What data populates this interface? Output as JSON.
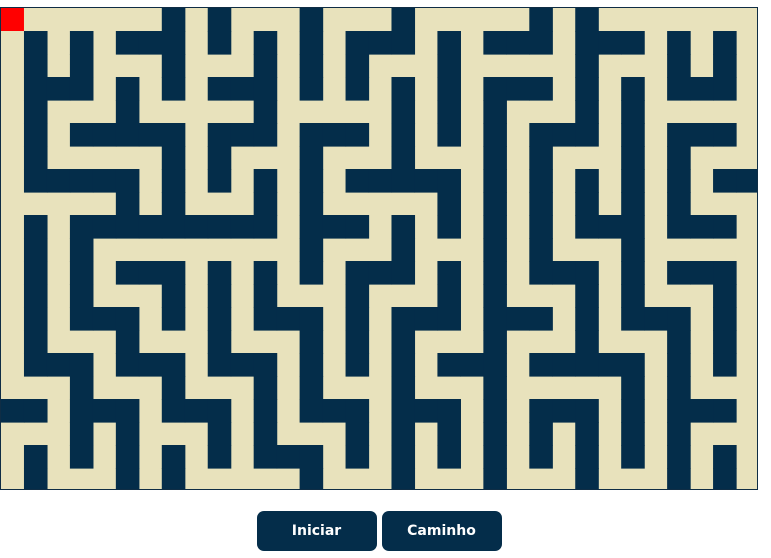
{
  "maze": {
    "wall_color": "#042d4a",
    "path_color": "#e8e2bc",
    "player_color": "#ff0000"
  },
  "buttons": {
    "start_label": "Iniciar",
    "path_label": "Caminho"
  }
}
